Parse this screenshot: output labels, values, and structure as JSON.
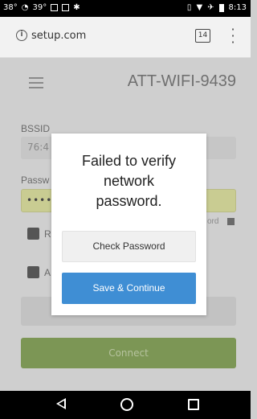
{
  "status_bar": {
    "temp1": "38°",
    "temp2": "39°",
    "time": "8:13"
  },
  "browser": {
    "url": "setup.com",
    "tab_count": "14",
    "info_icon": "info-icon",
    "menu_icon": "more-vert-icon"
  },
  "page": {
    "menu_icon": "hamburger-icon",
    "ssid_title": "ATT-WIFI-9439",
    "bssid_label": "BSSID",
    "bssid_value": "76:4",
    "password_label": "Passw",
    "password_value": "•••••",
    "show_password_partial": "ord",
    "checkbox1_label": "R",
    "checkbox2_label": "A",
    "cancel_label": "Cancel",
    "connect_label": "Connect"
  },
  "modal": {
    "message_line1": "Failed to verify",
    "message_line2": "network",
    "message_line3": "password.",
    "check_password_label": "Check Password",
    "save_continue_label": "Save & Continue"
  },
  "colors": {
    "connect_green": "#7c9655",
    "save_blue": "#3f8ed4",
    "password_field": "#c9cc92"
  }
}
